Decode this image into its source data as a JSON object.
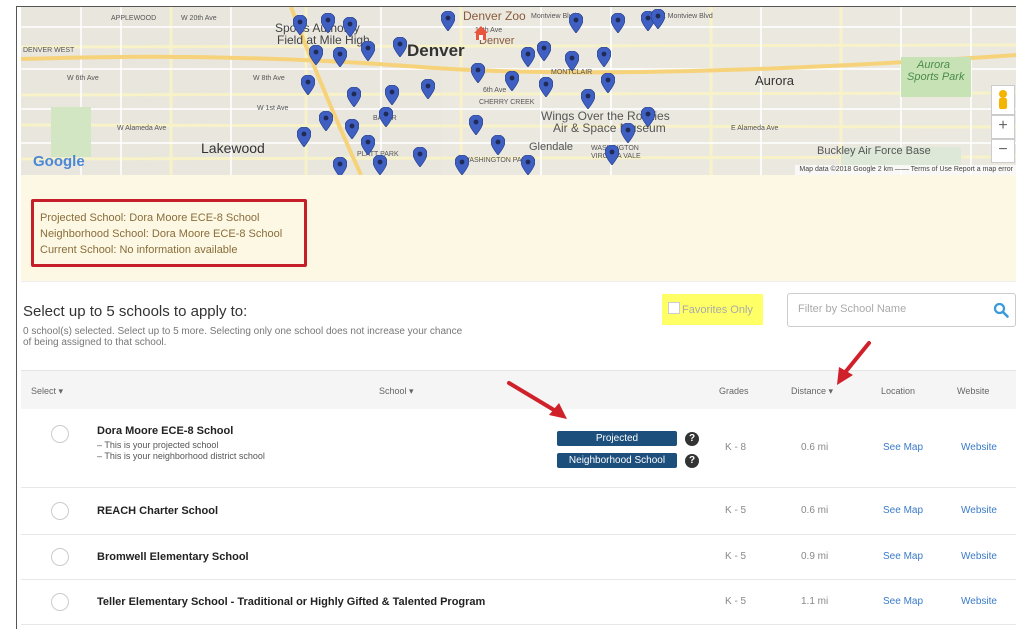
{
  "map": {
    "labels": {
      "applewood": "APPLEWOOD",
      "w20th": "W 20th Ave",
      "sports": "Sports Authority",
      "field": "Field at Mile High",
      "denver_zoo": "Denver Zoo",
      "montview": "Montview Blvd",
      "denver_west": "DENVER WEST",
      "denver": "Denver",
      "denver2": "Denver",
      "w6th": "W 6th Ave",
      "w8th": "W 8th Ave",
      "sixth": "6th Ave",
      "montclair": "MONTCLAIR",
      "aurora": "Aurora",
      "aurora_park": "Aurora",
      "aurora_park2": "Sports Park",
      "w1st": "W 1st Ave",
      "baker": "BAKER",
      "cherry": "CHERRY CREEK",
      "wings": "Wings Over the Rockies",
      "air": "Air & Space Museum",
      "w_alameda": "W Alameda Ave",
      "e_alameda": "E Alameda Ave",
      "lakewood": "Lakewood",
      "glendale": "Glendale",
      "washington": "WASHINGTON",
      "virginia": "VIRGINIA VALE",
      "platt": "PLATT PARK",
      "washington_park": "WASHINGTON PARK",
      "buckley": "Buckley Air Force Base",
      "e_montview": "E Montview Blvd",
      "ave18": "18th Ave"
    },
    "google": "Google",
    "footer": "Map data ©2018 Google   2 km ⎯⎯⎯⎯   Terms of Use   Report a map error",
    "zoom_in": "+",
    "zoom_out": "−"
  },
  "info": {
    "projected": "Projected School: Dora Moore ECE-8 School",
    "neighborhood": "Neighborhood School: Dora Moore ECE-8 School",
    "current": "Current School: No information available"
  },
  "select": {
    "heading": "Select up to 5 schools to apply to:",
    "subtext": "0 school(s) selected. Select up to 5 more. Selecting only one school does not increase your chance of being assigned to that school.",
    "favorites": "Favorites Only",
    "filter_placeholder": "Filter by School Name"
  },
  "table": {
    "headers": {
      "select": "Select ▾",
      "school": "School ▾",
      "grades": "Grades",
      "distance": "Distance ▾",
      "location": "Location",
      "website": "Website"
    },
    "rows": [
      {
        "name": "Dora Moore ECE-8 School",
        "notes": [
          "– This is your projected school",
          "– This is your neighborhood district school"
        ],
        "badges": [
          "Projected",
          "Neighborhood School"
        ],
        "grades": "K - 8",
        "distance": "0.6 mi",
        "location": "See Map",
        "website": "Website"
      },
      {
        "name": "REACH Charter School",
        "grades": "K - 5",
        "distance": "0.6 mi",
        "location": "See Map",
        "website": "Website"
      },
      {
        "name": "Bromwell Elementary School",
        "grades": "K - 5",
        "distance": "0.9 mi",
        "location": "See Map",
        "website": "Website"
      },
      {
        "name": "Teller Elementary School - Traditional or Highly Gifted & Talented Program",
        "grades": "K - 5",
        "distance": "1.1 mi",
        "location": "See Map",
        "website": "Website"
      }
    ]
  },
  "colors": {
    "highlight_box": "#c51f2a",
    "badge": "#1d4f7c",
    "info_bg": "#fcf8e3",
    "favorites_bg": "#ffff66",
    "pin": "#3f5fc2",
    "link": "#3a7bc8"
  },
  "icons": {
    "pin": "map-marker-icon",
    "home": "home-marker-icon",
    "search": "search-icon",
    "help": "question-circle-icon",
    "arrow": "red-arrow-icon"
  }
}
